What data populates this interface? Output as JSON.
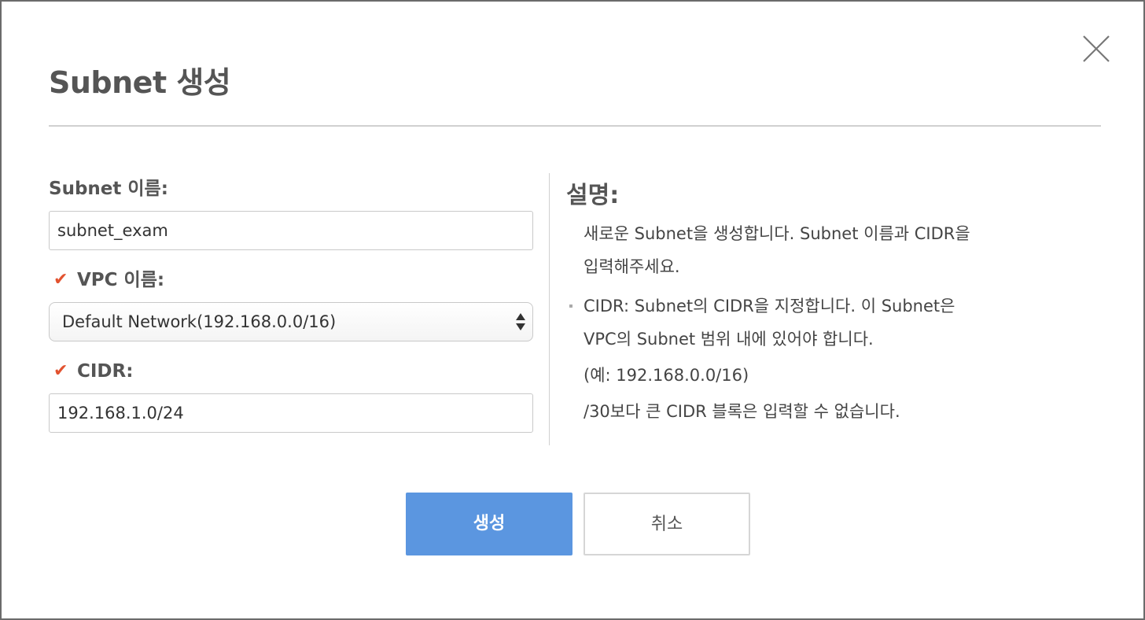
{
  "dialog": {
    "title": "Subnet 생성",
    "close_icon": "close-icon"
  },
  "form": {
    "subnet_name": {
      "label": "Subnet 이름:",
      "value": "subnet_exam"
    },
    "vpc_name": {
      "label": "VPC 이름:",
      "required_icon": "checkmark-icon",
      "selected": "Default Network(192.168.0.0/16)"
    },
    "cidr": {
      "label": "CIDR:",
      "required_icon": "checkmark-icon",
      "value": "192.168.1.0/24"
    }
  },
  "description": {
    "title": "설명:",
    "intro_line1": "새로운 Subnet을 생성합니다. Subnet 이름과 CIDR을",
    "intro_line2": "입력해주세요.",
    "cidr_line1": "CIDR: Subnet의 CIDR을 지정합니다. 이 Subnet은",
    "cidr_line2": "VPC의 Subnet 범위 내에 있어야 합니다.",
    "cidr_line3": "(예: 192.168.0.0/16)",
    "cidr_line4": "/30보다 큰 CIDR 블록은 입력할 수 없습니다."
  },
  "buttons": {
    "create": "생성",
    "cancel": "취소"
  },
  "colors": {
    "primary": "#5b96e0",
    "required": "#e2522f"
  }
}
